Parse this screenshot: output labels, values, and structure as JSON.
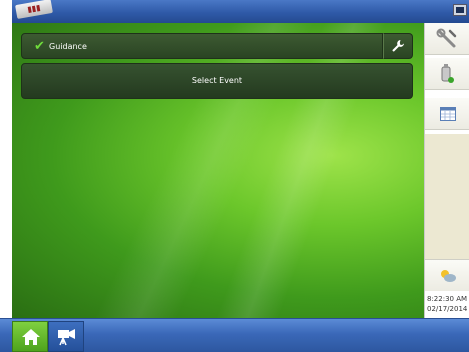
{
  "topbar": {
    "signal_icon": "signal-strength-icon",
    "display_icon": "display-icon"
  },
  "main": {
    "guidance": {
      "label": "Guidance",
      "check_icon": "check-icon",
      "wrench_icon": "wrench-icon"
    },
    "select_event_label": "Select Event"
  },
  "sidebar": {
    "buttons": [
      {
        "icon": "tools-icon"
      },
      {
        "icon": "gps-receiver-icon"
      },
      {
        "icon": "calendar-icon"
      }
    ],
    "weather_icon": "weather-icon",
    "time": "8:22:30 AM",
    "date": "02/17/2014"
  },
  "bottombar": {
    "home_icon": "home-icon",
    "video_icon": "video-camera-icon"
  },
  "colors": {
    "accent_green": "#6cc72b",
    "bar_blue": "#2f5aa8",
    "check_green": "#6fdc3b"
  }
}
